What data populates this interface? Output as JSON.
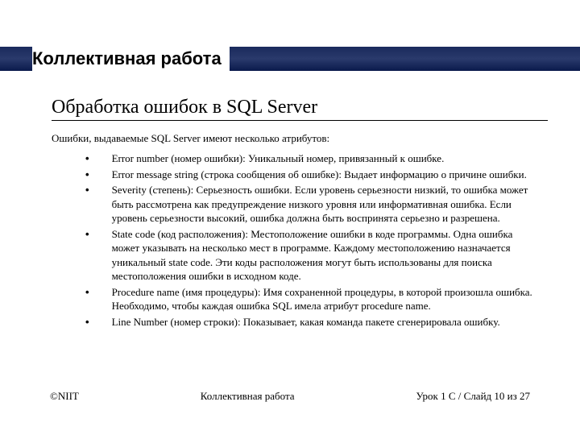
{
  "title": "Коллективная работа",
  "subtitle": "Обработка ошибок в SQL Server",
  "intro": "Ошибки, выдаваемые SQL Server имеют несколько атрибутов:",
  "bullets": [
    "Error number (номер ошибки): Уникальный номер, привязанный к ошибке.",
    "Error message string (строка сообщения об ошибке): Выдает информацию о причине ошибки.",
    "Severity (степень): Серьезность ошибки. Если уровень серьезности низкий, то ошибка может быть рассмотрена как предупреждение низкого уровня или информативная ошибка. Если уровень серьезности высокий, ошибка должна быть воспринята серьезно и разрешена.",
    "State code (код расположения): Местоположение ошибки в коде программы. Одна ошибка может указывать на несколько мест в программе. Каждому местоположению назначается уникальный state code. Эти коды расположения могут быть использованы для поиска местоположения ошибки в исходном коде.",
    "Procedure name (имя процедуры): Имя сохраненной процедуры, в которой произошла ошибка. Необходимо, чтобы каждая ошибка SQL имела атрибут procedure name.",
    "Line Number (номер строки): Показывает, какая команда пакете сгенерировала ошибку."
  ],
  "footer": {
    "left": "©NIIT",
    "center": "Коллективная работа",
    "right": "Урок 1 C / Слайд 10 из 27"
  }
}
